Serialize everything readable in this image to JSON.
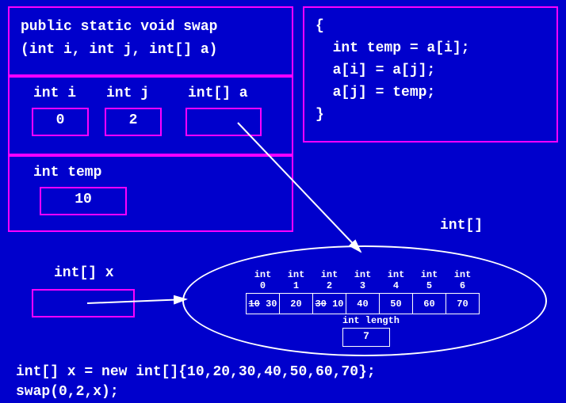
{
  "signature": {
    "line1": "public static void swap",
    "line2": "(int i, int j, int[] a)"
  },
  "body": "{\n  int temp = a[i];\n  a[i] = a[j];\n  a[j] = temp;\n}",
  "locals": {
    "i": {
      "label": "int  i",
      "value": "0"
    },
    "j": {
      "label": "int  j",
      "value": "2"
    },
    "a": {
      "label": "int[] a",
      "value": ""
    },
    "temp": {
      "label": "int  temp",
      "value": "10"
    }
  },
  "x_var": {
    "label": "int[] x"
  },
  "heap": {
    "type_label": "int[]",
    "headers": [
      "int 0",
      "int 1",
      "int 2",
      "int 3",
      "int 4",
      "int 5",
      "int 6"
    ],
    "cells": [
      {
        "old": "10",
        "new": "30"
      },
      {
        "old": null,
        "new": "20"
      },
      {
        "old": "30",
        "new": "10"
      },
      {
        "old": null,
        "new": "40"
      },
      {
        "old": null,
        "new": "50"
      },
      {
        "old": null,
        "new": "60"
      },
      {
        "old": null,
        "new": "70"
      }
    ],
    "length": {
      "label": "int  length",
      "value": "7"
    }
  },
  "driver": "int[] x = new int[]{10,20,30,40,50,60,70};\nswap(0,2,x);"
}
